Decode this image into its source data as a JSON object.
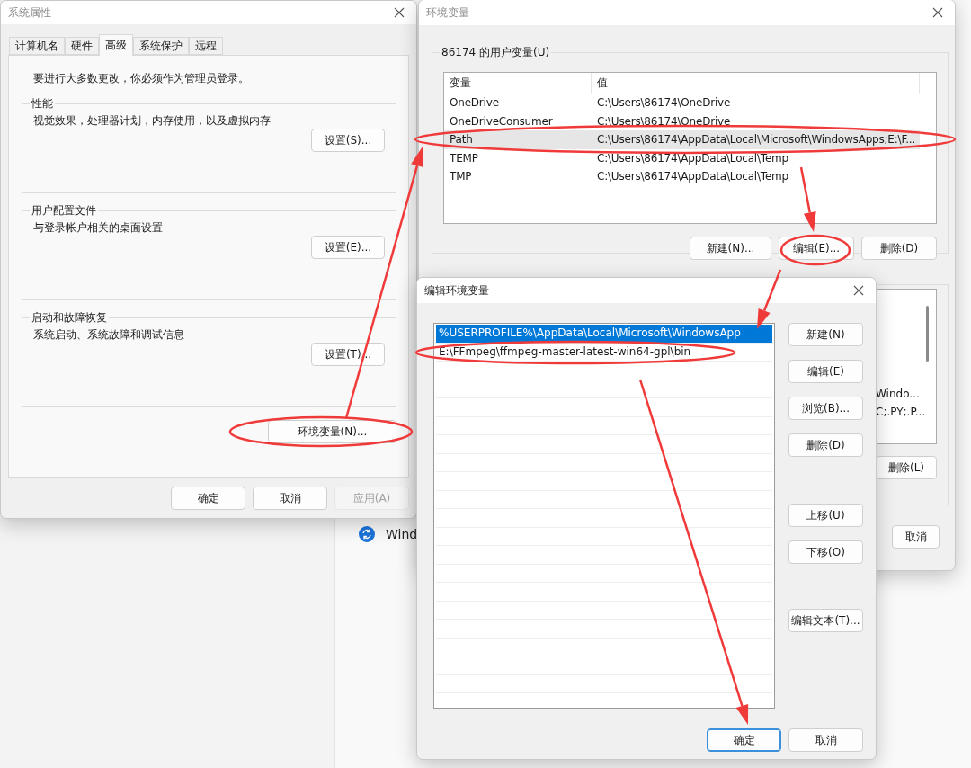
{
  "background": {
    "items": [
      {
        "label": "Wind"
      }
    ]
  },
  "system_properties": {
    "title": "系统属性",
    "tabs": [
      {
        "label": "计算机名",
        "selected": false
      },
      {
        "label": "硬件",
        "selected": false
      },
      {
        "label": "高级",
        "selected": true
      },
      {
        "label": "系统保护",
        "selected": false
      },
      {
        "label": "远程",
        "selected": false
      }
    ],
    "admin_note": "要进行大多数更改，你必须作为管理员登录。",
    "groups": [
      {
        "title": "性能",
        "description": "视觉效果，处理器计划，内存使用，以及虚拟内存",
        "button": "设置(S)..."
      },
      {
        "title": "用户配置文件",
        "description": "与登录帐户相关的桌面设置",
        "button": "设置(E)..."
      },
      {
        "title": "启动和故障恢复",
        "description": "系统启动、系统故障和调试信息",
        "button": "设置(T)..."
      }
    ],
    "env_button": "环境变量(N)...",
    "buttons": [
      {
        "label": "确定",
        "disabled": false
      },
      {
        "label": "取消",
        "disabled": false
      },
      {
        "label": "应用(A)",
        "disabled": true
      }
    ]
  },
  "environment_variables": {
    "title": "环境变量",
    "user_group": {
      "title": "86174 的用户变量(U)",
      "columns": [
        "变量",
        "值"
      ],
      "rows": [
        {
          "name": "OneDrive",
          "value": "C:\\Users\\86174\\OneDrive",
          "selected": false
        },
        {
          "name": "OneDriveConsumer",
          "value": "C:\\Users\\86174\\OneDrive",
          "selected": false
        },
        {
          "name": "Path",
          "value": "C:\\Users\\86174\\AppData\\Local\\Microsoft\\WindowsApps;E:\\F...",
          "selected": true
        },
        {
          "name": "TEMP",
          "value": "C:\\Users\\86174\\AppData\\Local\\Temp",
          "selected": false
        },
        {
          "name": "TMP",
          "value": "C:\\Users\\86174\\AppData\\Local\\Temp",
          "selected": false
        }
      ],
      "buttons": [
        "新建(N)...",
        "编辑(E)...",
        "删除(D)"
      ]
    },
    "system_group": {
      "rows": [
        "Windo...",
        "C;.PY;.P..."
      ],
      "buttons": [
        "删除(L)"
      ]
    },
    "buttons": [
      "取消"
    ]
  },
  "edit_dialog": {
    "title": "编辑环境变量",
    "entries": [
      {
        "text": "%USERPROFILE%\\AppData\\Local\\Microsoft\\WindowsApp",
        "selected": true
      },
      {
        "text": "E:\\FFmpeg\\ffmpeg-master-latest-win64-gpl\\bin",
        "selected": false
      }
    ],
    "side_buttons": [
      "新建(N)",
      "编辑(E)",
      "浏览(B)...",
      "删除(D)",
      "上移(U)",
      "下移(O)",
      "编辑文本(T)..."
    ],
    "buttons": [
      {
        "label": "确定",
        "default": true
      },
      {
        "label": "取消",
        "default": false
      }
    ]
  }
}
